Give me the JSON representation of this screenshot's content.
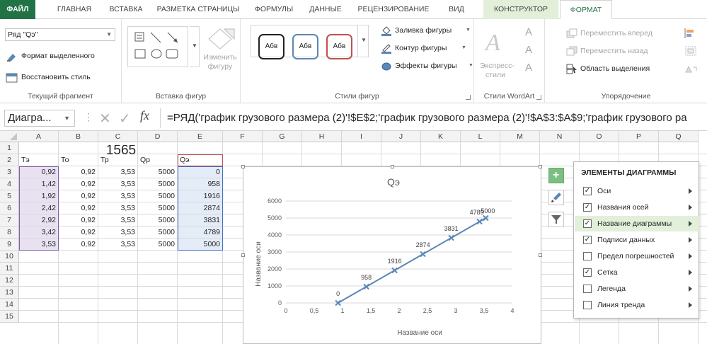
{
  "tabs": [
    "ФАЙЛ",
    "ГЛАВНАЯ",
    "ВСТАВКА",
    "РАЗМЕТКА СТРАНИЦЫ",
    "ФОРМУЛЫ",
    "ДАННЫЕ",
    "РЕЦЕНЗИРОВАНИЕ",
    "ВИД",
    "КОНСТРУКТОР",
    "ФОРМАТ"
  ],
  "ribbon": {
    "current_fragment": {
      "selector_value": "Ряд \"Qэ\"",
      "format_selected": "Формат выделенного",
      "reset_style": "Восстановить стиль",
      "label": "Текущий фрагмент"
    },
    "insert_shapes": {
      "change_shape": "Изменить фигуру",
      "label": "Вставка фигур"
    },
    "shape_styles": {
      "style_sample": "Абв",
      "fill": "Заливка фигуры",
      "outline": "Контур фигуры",
      "effects": "Эффекты фигуры",
      "label": "Стили фигур"
    },
    "wordart": {
      "quick_styles": "Экспресс-стили",
      "label": "Стили WordArt"
    },
    "arrange": {
      "bring_forward": "Переместить вперед",
      "send_backward": "Переместить назад",
      "selection_pane": "Область выделения",
      "label": "Упорядочение"
    }
  },
  "formula_bar": {
    "name_box": "Диагра...",
    "fx": "fx",
    "formula": "=РЯД('график грузового размера  (2)'!$E$2;'график грузового размера  (2)'!$A$3:$A$9;'график грузового ра"
  },
  "sheet": {
    "columns": [
      "A",
      "B",
      "C",
      "D",
      "E",
      "F",
      "G",
      "H",
      "I",
      "J",
      "K",
      "L",
      "M",
      "N",
      "O",
      "P",
      "Q"
    ],
    "rows": [
      "1",
      "2",
      "3",
      "4",
      "5",
      "6",
      "7",
      "8",
      "9",
      "10",
      "11",
      "12",
      "13",
      "14",
      "15"
    ],
    "title_value": "1565",
    "headers": [
      "Тэ",
      "То",
      "Тр",
      "Qр",
      "Qэ"
    ],
    "data": [
      [
        "0,92",
        "0,92",
        "3,53",
        "5000",
        "0"
      ],
      [
        "1,42",
        "0,92",
        "3,53",
        "5000",
        "958"
      ],
      [
        "1,92",
        "0,92",
        "3,53",
        "5000",
        "1916"
      ],
      [
        "2,42",
        "0,92",
        "3,53",
        "5000",
        "2874"
      ],
      [
        "2,92",
        "0,92",
        "3,53",
        "5000",
        "3831"
      ],
      [
        "3,42",
        "0,92",
        "3,53",
        "5000",
        "4789"
      ],
      [
        "3,53",
        "0,92",
        "3,53",
        "5000",
        "5000"
      ]
    ]
  },
  "chart_data": {
    "type": "scatter",
    "title": "Qэ",
    "xlabel": "Название оси",
    "ylabel": "Название оси",
    "xlim": [
      0,
      4
    ],
    "ylim": [
      0,
      6000
    ],
    "x_ticks": [
      "0",
      "0,5",
      "1",
      "1,5",
      "2",
      "2,5",
      "3",
      "3,5",
      "4"
    ],
    "y_ticks": [
      "0",
      "1000",
      "2000",
      "3000",
      "4000",
      "5000",
      "6000"
    ],
    "grid": true,
    "legend": false,
    "series": [
      {
        "x": [
          0.92,
          1.42,
          1.92,
          2.42,
          2.92,
          3.42,
          3.53
        ],
        "y": [
          0,
          958,
          1916,
          2874,
          3831,
          4789,
          5000
        ],
        "labels": [
          "0",
          "958",
          "1916",
          "2874",
          "3831",
          "4789",
          "5000"
        ],
        "color": "#5b86b7"
      }
    ]
  },
  "chart_elements_panel": {
    "title": "ЭЛЕМЕНТЫ ДИАГРАММЫ",
    "items": [
      {
        "label": "Оси",
        "checked": true
      },
      {
        "label": "Названия осей",
        "checked": true
      },
      {
        "label": "Название диаграммы",
        "checked": true
      },
      {
        "label": "Подписи данных",
        "checked": true
      },
      {
        "label": "Предел погрешностей",
        "checked": false
      },
      {
        "label": "Сетка",
        "checked": true
      },
      {
        "label": "Легенда",
        "checked": false
      },
      {
        "label": "Линия тренда",
        "checked": false
      }
    ]
  },
  "colors": {
    "excel_green": "#217346",
    "series": "#5b86b7",
    "highlight": "#e2efda"
  }
}
